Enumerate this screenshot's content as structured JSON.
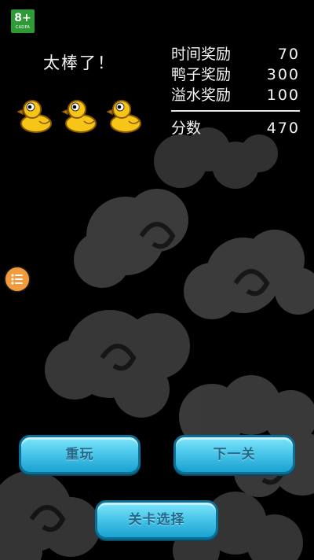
{
  "badge": {
    "age": "8+",
    "org": "CADPA"
  },
  "result": {
    "praise": "太棒了！",
    "ducks_collected": 3
  },
  "scores": [
    {
      "label": "时间奖励",
      "value": "70"
    },
    {
      "label": "鸭子奖励",
      "value": "300"
    },
    {
      "label": "溢水奖励",
      "value": "100"
    }
  ],
  "total": {
    "label": "分数",
    "value": "470"
  },
  "buttons": {
    "replay": "重玩",
    "next": "下一关",
    "levels": "关卡选择"
  },
  "colors": {
    "background": "#000000",
    "button_face": "#4cc7ea",
    "button_border": "#0e6e94",
    "menu_badge": "#f39a3c",
    "age_badge": "#2f9a35",
    "duck_body": "#f7c518"
  },
  "icons": {
    "side_menu": "menu-list-icon",
    "duck": "rubber-duck-icon"
  }
}
